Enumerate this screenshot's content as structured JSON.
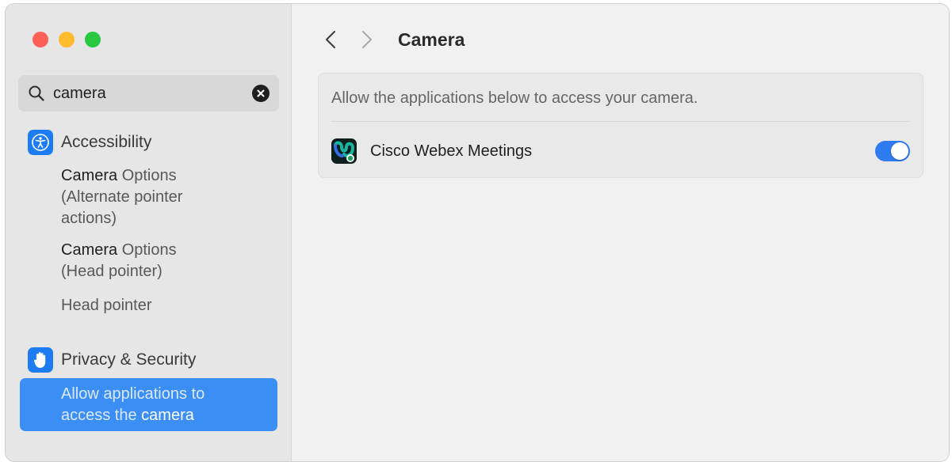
{
  "window": {
    "traffic_lights": [
      "close",
      "minimize",
      "zoom"
    ],
    "colors": {
      "red": "#fe5f57",
      "yellow": "#febc2e",
      "green": "#28c840",
      "accent": "#3b8ef4"
    }
  },
  "sidebar": {
    "search": {
      "value": "camera",
      "icon": "magnifying-glass",
      "clear_icon": "x-circle"
    },
    "sections": [
      {
        "title": "Accessibility",
        "icon": "accessibility-icon",
        "items": [
          {
            "highlight": "Camera",
            "rest": " Options",
            "line2": "(Alternate pointer",
            "line3": "actions)"
          },
          {
            "highlight": "Camera",
            "rest": " Options",
            "line2": "(Head pointer)"
          },
          {
            "text": "Head pointer"
          }
        ]
      },
      {
        "title": "Privacy & Security",
        "icon": "hand-icon",
        "items": [
          {
            "line1": "Allow applications to",
            "pre": "access the ",
            "highlight": "camera",
            "selected": true
          }
        ]
      }
    ]
  },
  "main": {
    "nav": {
      "back_icon": "chevron-left",
      "forward_icon": "chevron-right"
    },
    "title": "Camera",
    "description": "Allow the applications below to access your camera.",
    "apps": [
      {
        "name": "Cisco Webex Meetings",
        "icon": "webex-icon",
        "enabled": true
      }
    ]
  }
}
